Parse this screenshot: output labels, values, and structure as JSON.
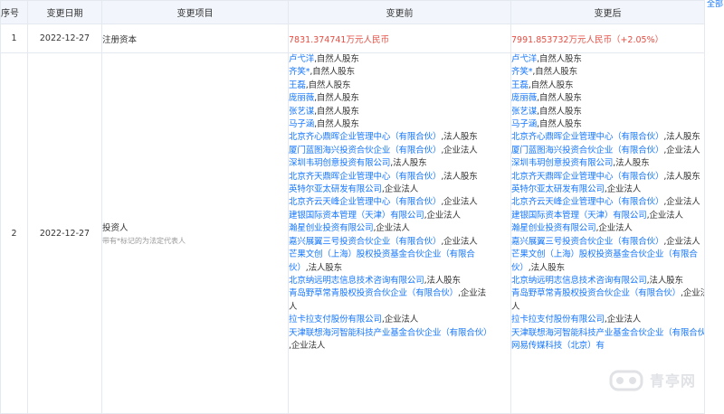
{
  "headers": {
    "seq": "序号",
    "date": "变更日期",
    "item": "变更项目",
    "before": "变更前",
    "after": "变更后"
  },
  "all_label": "全部",
  "rows": [
    {
      "seq": "1",
      "date": "2022-12-27",
      "item": "注册资本",
      "before": "7831.374741万元人民币",
      "after_value": "7991.853732万元人民币",
      "after_change": "（+2.05%）"
    },
    {
      "seq": "2",
      "date": "2022-12-27",
      "item": "投资人",
      "note": "带有*标记的为法定代表人",
      "before_lines": [
        {
          "name": "卢弋洋",
          "role": ",自然人股东"
        },
        {
          "name": "齐笑*",
          "role": ",自然人股东"
        },
        {
          "name": "王磊",
          "role": ",自然人股东"
        },
        {
          "name": "庞丽薇",
          "role": ",自然人股东"
        },
        {
          "name": "张艺谋",
          "role": ",自然人股东"
        },
        {
          "name": "马子涵",
          "role": ",自然人股东"
        },
        {
          "name": "北京齐心鼎晖企业管理中心（有限合伙）",
          "role": ",法人股东"
        },
        {
          "name": "厦门蓝图海兴投资合伙企业（有限合伙）",
          "role": ",企业法人"
        },
        {
          "name": "深圳韦玥创意投资有限公司",
          "role": ",法人股东"
        },
        {
          "name": "北京齐天鼎晖企业管理中心（有限合伙）",
          "role": ",法人股东"
        },
        {
          "name": "英特尔亚太研发有限公司",
          "role": ",企业法人"
        },
        {
          "name": "北京齐云天峰企业管理中心（有限合伙）",
          "role": ",企业法人"
        },
        {
          "name": "建银国际资本管理（天津）有限公司",
          "role": ",企业法人"
        },
        {
          "name": "瀚星创业投资有限公司",
          "role": ",企业法人"
        },
        {
          "name": "嘉兴展翼三号投资合伙企业（有限合伙）",
          "role": ",企业法人"
        },
        {
          "name": "芒果文创（上海）股权投资基金合伙企业（有限合",
          "role": ""
        },
        {
          "name": "伙）",
          "role": ",法人股东"
        },
        {
          "name": "北京纳远明志信息技术咨询有限公司",
          "role": ",法人股东"
        },
        {
          "name": "青岛野草常青股权投资合伙企业（有限合伙）",
          "role": ",企业法"
        },
        {
          "name": "",
          "role": "人"
        },
        {
          "name": "拉卡拉支付股份有限公司",
          "role": ",企业法人"
        },
        {
          "name": "天津联想海河智能科技产业基金合伙企业（有限合伙）",
          "role": ""
        },
        {
          "name": "",
          "role": ",企业法人"
        }
      ],
      "after_lines": [
        {
          "name": "卢弋洋",
          "role": ",自然人股东"
        },
        {
          "name": "齐笑*",
          "role": ",自然人股东"
        },
        {
          "name": "王磊",
          "role": ",自然人股东"
        },
        {
          "name": "庞丽薇",
          "role": ",自然人股东"
        },
        {
          "name": "张艺谋",
          "role": ",自然人股东"
        },
        {
          "name": "马子涵",
          "role": ",自然人股东"
        },
        {
          "name": "北京齐心鼎晖企业管理中心（有限合伙）",
          "role": ",法人股东"
        },
        {
          "name": "厦门蓝图海兴投资合伙企业（有限合伙）",
          "role": ",企业法人"
        },
        {
          "name": "深圳韦玥创意投资有限公司",
          "role": ",法人股东"
        },
        {
          "name": "北京齐天鼎晖企业管理中心（有限合伙）",
          "role": ",法人股东"
        },
        {
          "name": "英特尔亚太研发有限公司",
          "role": ",企业法人"
        },
        {
          "name": "北京齐云天峰企业管理中心（有限合伙）",
          "role": ",企业法人"
        },
        {
          "name": "建银国际资本管理（天津）有限公司",
          "role": ",企业法人"
        },
        {
          "name": "瀚星创业投资有限公司",
          "role": ",企业法人"
        },
        {
          "name": "嘉兴展翼三号投资合伙企业（有限合伙）",
          "role": ",企业法人"
        },
        {
          "name": "芒果文创（上海）股权投资基金合伙企业（有限合",
          "role": ""
        },
        {
          "name": "伙）",
          "role": ",法人股东"
        },
        {
          "name": "北京纳远明志信息技术咨询有限公司",
          "role": ",法人股东"
        },
        {
          "name": "青岛野草常青股权投资合伙企业（有限合伙）",
          "role": ",企业法"
        },
        {
          "name": "",
          "role": "人"
        },
        {
          "name": "拉卡拉支付股份有限公司",
          "role": ",企业法人"
        },
        {
          "name": "天津联想海河智能科技产业基金合伙企业（有限合伙）",
          "role": ""
        },
        {
          "name": "网易传媒科技（北京）有",
          "role": ""
        }
      ]
    }
  ],
  "watermark": {
    "text": "青亭网"
  }
}
